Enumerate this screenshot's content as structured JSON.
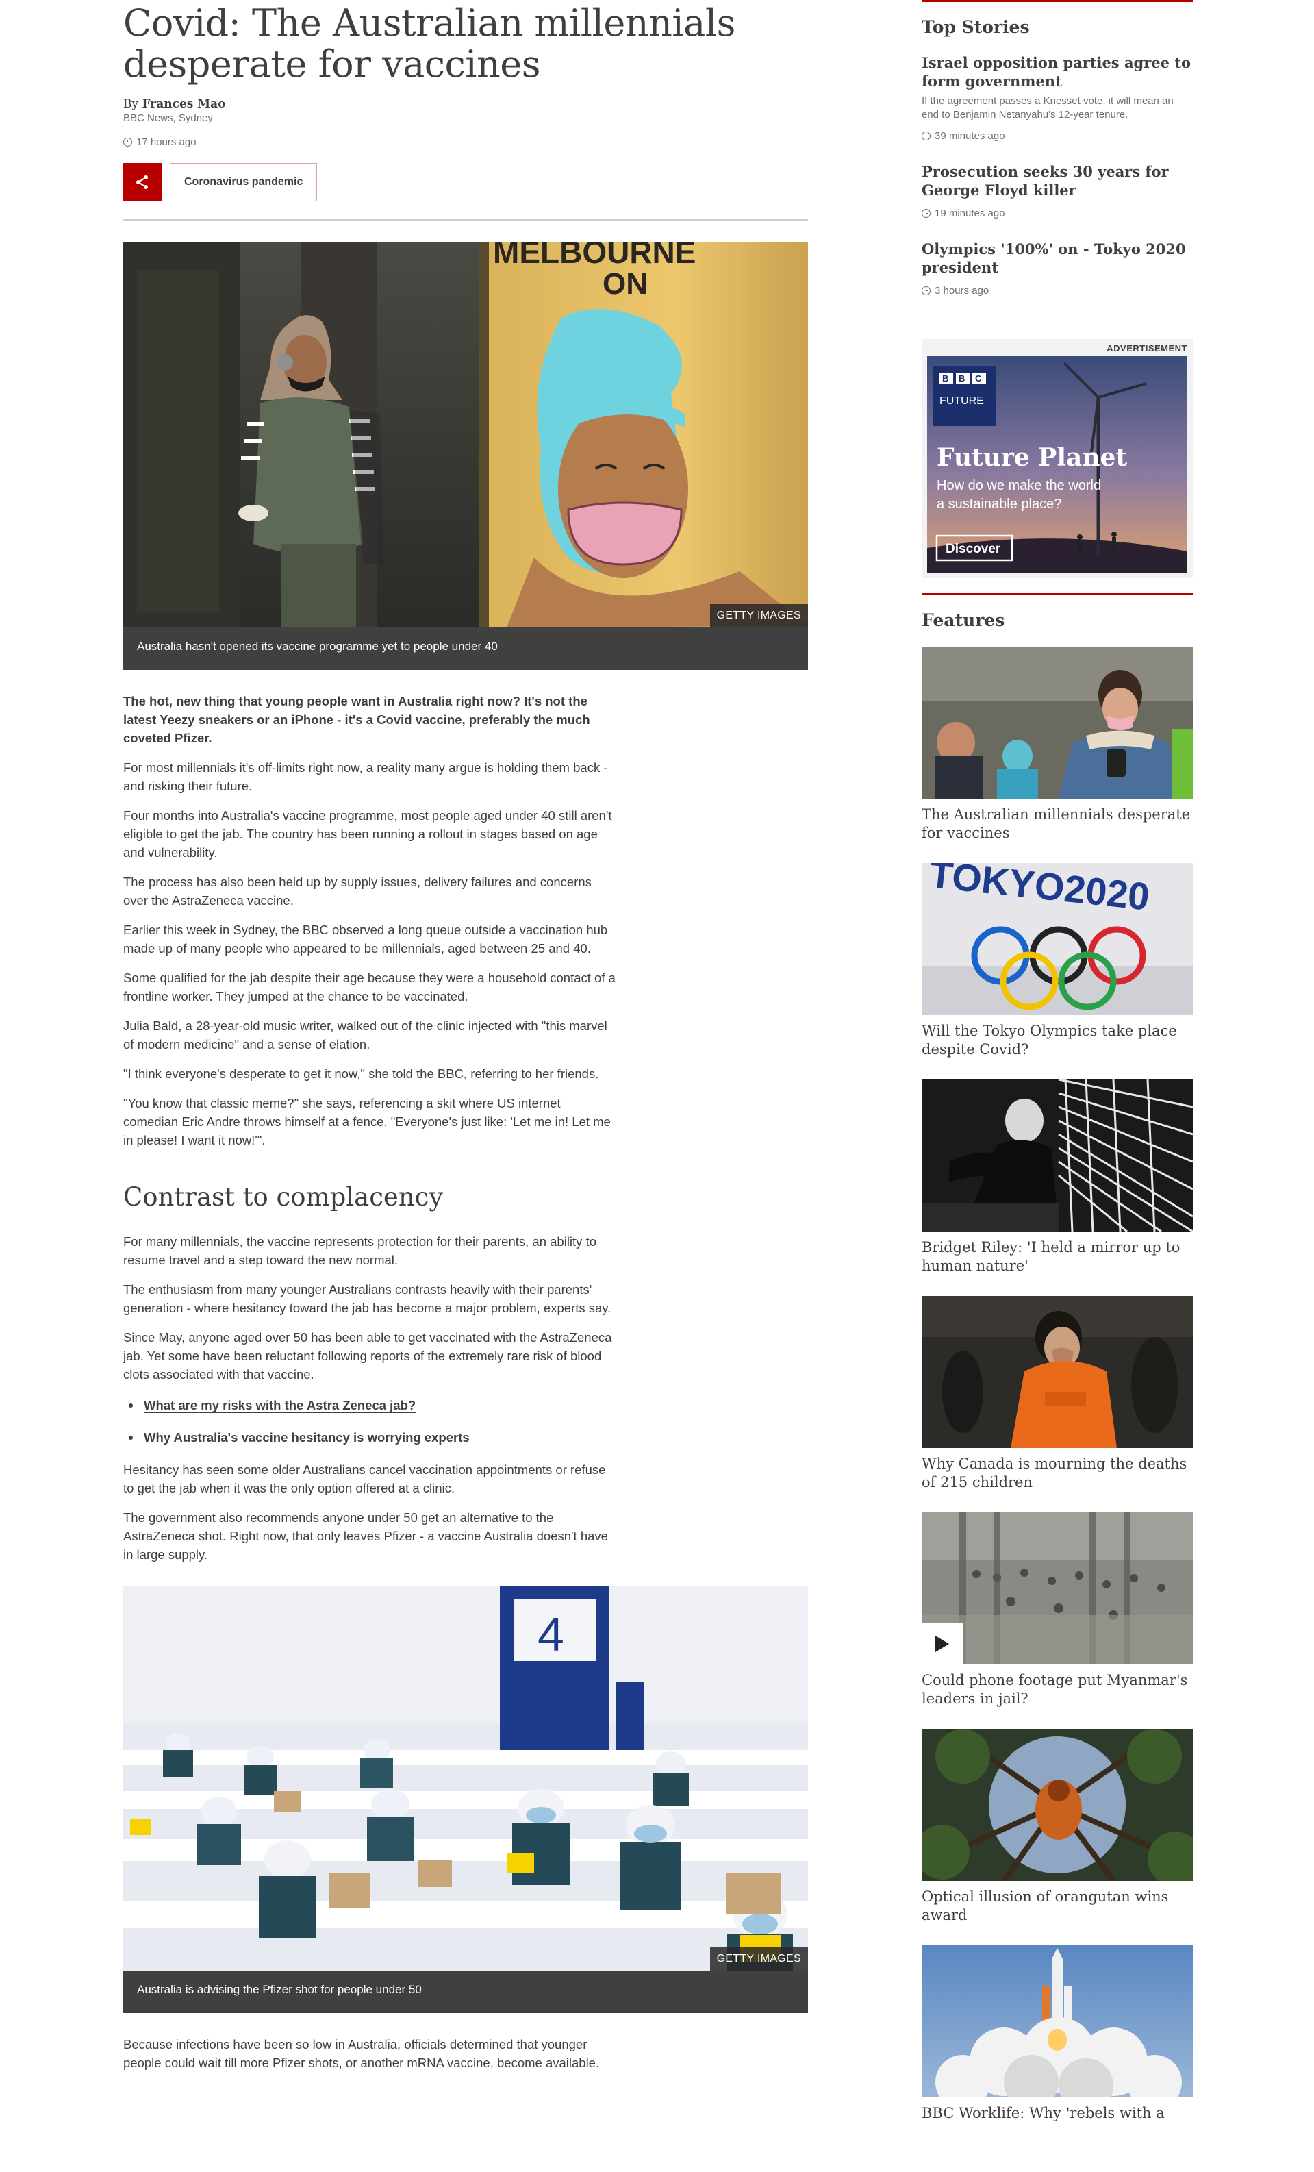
{
  "article": {
    "headline": "Covid: The Australian millennials desperate for vaccines",
    "byline_prefix": "By ",
    "author": "Frances Mao",
    "org": "BBC News, Sydney",
    "time": "17 hours ago",
    "topic": "Coronavirus pandemic",
    "image1": {
      "credit": "GETTY IMAGES",
      "caption": "Australia hasn't opened its vaccine programme yet to people under 40",
      "sign_text_1": "MELBOURNE",
      "sign_text_2": "ON"
    },
    "paragraphs_a": [
      "The hot, new thing that young people want in Australia right now? It's not the latest Yeezy sneakers or an iPhone - it's a Covid vaccine, preferably the much coveted Pfizer.",
      "For most millennials it's off-limits right now, a reality many argue is holding them back - and risking their future.",
      "Four months into Australia's vaccine programme, most people aged under 40 still aren't eligible to get the jab. The country has been running a rollout in stages based on age and vulnerability.",
      "The process has also been held up by supply issues, delivery failures and concerns over the AstraZeneca vaccine.",
      "Earlier this week in Sydney, the BBC observed a long queue outside a vaccination hub made up of many people who appeared to be millennials, aged between 25 and 40.",
      "Some qualified for the jab despite their age because they were a household contact of a frontline worker. They jumped at the chance to be vaccinated.",
      "Julia Bald, a 28-year-old music writer, walked out of the clinic injected with \"this marvel of modern medicine\" and a sense of elation.",
      "\"I think everyone's desperate to get it now,\" she told the BBC, referring to her friends.",
      "\"You know that classic meme?\" she says, referencing a skit where US internet comedian Eric Andre throws himself at a fence. \"Everyone's just like: 'Let me in! Let me in please! I want it now!'\"."
    ],
    "subheading": "Contrast to complacency",
    "paragraphs_b": [
      "For many millennials, the vaccine represents protection for their parents, an ability to resume travel and a step toward the new normal.",
      "The enthusiasm from many younger Australians contrasts heavily with their parents' generation - where hesitancy toward the jab has become a major problem, experts say.",
      "Since May, anyone aged over 50 has been able to get vaccinated with the AstraZeneca jab. Yet some have been reluctant following reports of the extremely rare risk of blood clots associated with that vaccine."
    ],
    "links": [
      "What are my risks with the Astra Zeneca jab?",
      "Why Australia's vaccine hesitancy is worrying experts"
    ],
    "paragraphs_c": [
      "Hesitancy has seen some older Australians cancel vaccination appointments or refuse to get the jab when it was the only option offered at a clinic.",
      "The government also recommends anyone under 50 get an alternative to the AstraZeneca shot. Right now, that only leaves Pfizer - a vaccine Australia doesn't have in large supply."
    ],
    "image2": {
      "credit": "GETTY IMAGES",
      "caption": "Australia is advising the Pfizer shot for people under 50",
      "sign_number": "4"
    },
    "paragraph_d": "Because infections have been so low in Australia, officials determined that younger people could wait till more Pfizer shots, or another mRNA vaccine, become available."
  },
  "sidebar": {
    "top_stories_heading": "Top Stories",
    "stories": [
      {
        "title": "Israel opposition parties agree to form government",
        "summary": "If the agreement passes a Knesset vote, it will mean an end to Benjamin Netanyahu's 12-year tenure.",
        "time": "39 minutes ago"
      },
      {
        "title": "Prosecution seeks 30 years for George Floyd killer",
        "summary": "",
        "time": "19 minutes ago"
      },
      {
        "title": "Olympics '100%' on - Tokyo 2020 president",
        "summary": "",
        "time": "3 hours ago"
      }
    ],
    "ad": {
      "label": "ADVERTISEMENT",
      "brand_line1": "BBC",
      "brand_line2": "FUTURE",
      "title": "Future Planet",
      "text": "How do we make the world a sustainable place?",
      "cta": "Discover"
    },
    "features_heading": "Features",
    "features": [
      {
        "title": "The Australian millennials desperate for vaccines",
        "icon": "photo"
      },
      {
        "title": "Will the Tokyo Olympics take place despite Covid?",
        "icon": "photo",
        "sign_text": "TOKYO2020"
      },
      {
        "title": "Bridget Riley: 'I held a mirror up to human nature'",
        "icon": "photo"
      },
      {
        "title": "Why Canada is mourning the deaths of 215 children",
        "icon": "photo"
      },
      {
        "title": "Could phone footage put Myanmar's leaders in jail?",
        "icon": "video-play"
      },
      {
        "title": "Optical illusion of orangutan wins award",
        "icon": "photo"
      },
      {
        "title": "BBC Worklife: Why 'rebels with a",
        "icon": "photo"
      }
    ]
  },
  "colors": {
    "accent": "#b80000",
    "text": "#3f3f42",
    "muted": "#6e6e73",
    "caption_bg": "#404040"
  }
}
